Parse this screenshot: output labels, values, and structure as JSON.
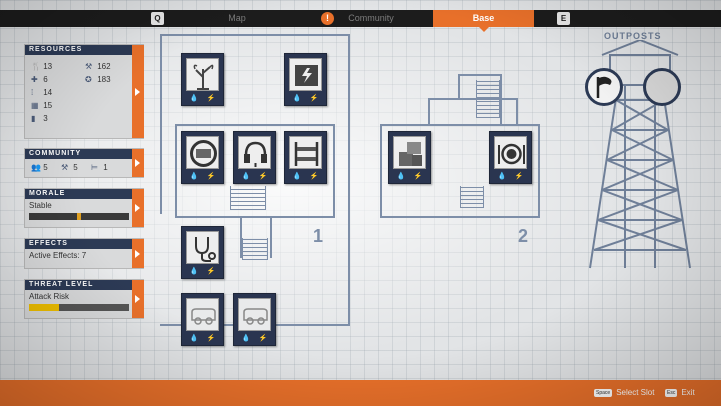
{
  "topbar": {
    "key_left": "Q",
    "key_right": "E",
    "tabs": [
      {
        "label": "Map"
      },
      {
        "label": "Community"
      },
      {
        "label": "Base"
      }
    ],
    "alert_glyph": "!"
  },
  "resources": {
    "title": "RESOURCES",
    "items": [
      {
        "icon": "food-icon",
        "value": "13"
      },
      {
        "icon": "medicine-icon",
        "value": "6"
      },
      {
        "icon": "ammo-icon",
        "value": "14"
      },
      {
        "icon": "materials-icon",
        "value": "15"
      },
      {
        "icon": "fuel-icon",
        "value": "3"
      },
      {
        "icon": "tools-icon",
        "value": "162"
      },
      {
        "icon": "influence-icon",
        "value": "183"
      }
    ]
  },
  "community": {
    "title": "COMMUNITY",
    "survivors": "5",
    "workers": "5",
    "beds": "1"
  },
  "morale": {
    "title": "MORALE",
    "status": "Stable",
    "level": 0.5
  },
  "effects": {
    "title": "EFFECTS",
    "text": "Active Effects: 7"
  },
  "threat": {
    "title": "THREAT LEVEL",
    "status": "Attack Risk",
    "level": 0.3
  },
  "base": {
    "building_1_label": "1",
    "building_2_label": "2"
  },
  "outposts": {
    "title": "OUTPOSTS"
  },
  "bottombar": {
    "select_key": "Space",
    "select_label": "Select Slot",
    "exit_key": "Esc",
    "exit_label": "Exit"
  },
  "colors": {
    "accent": "#e8702a",
    "navy": "#2c3a55",
    "blueprint": "#7d8ea8"
  }
}
